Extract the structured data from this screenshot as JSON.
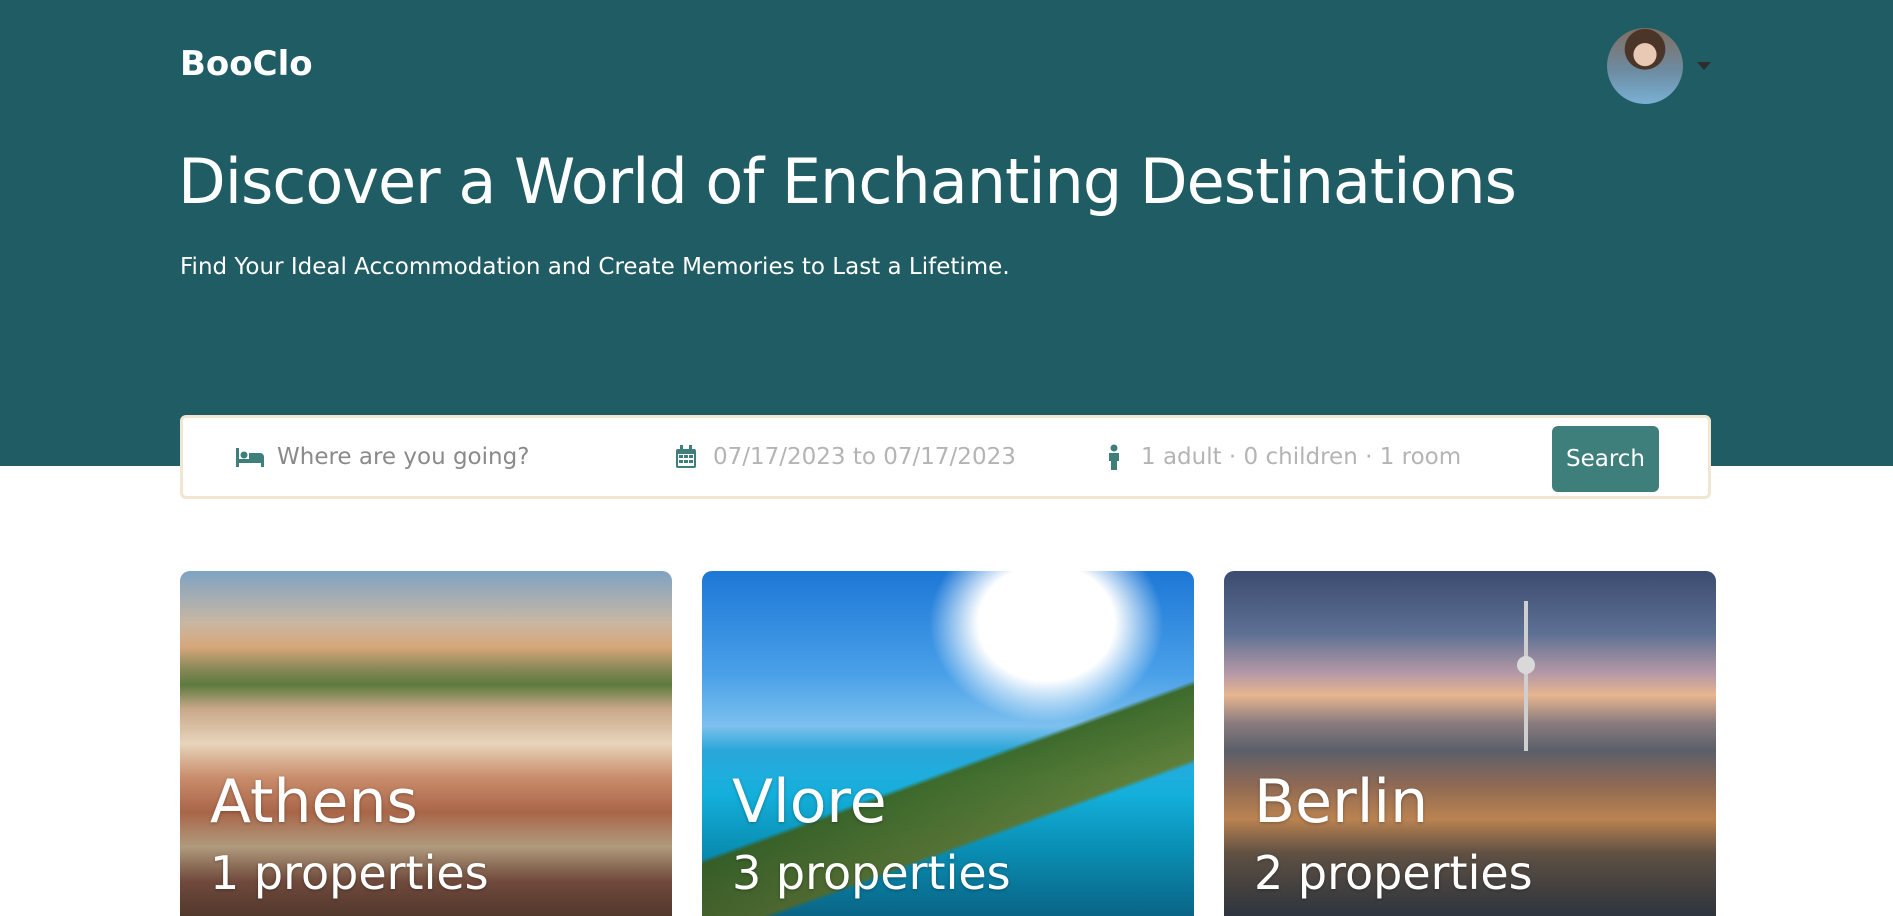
{
  "header": {
    "brand": "BooClo",
    "avatar_icon": "user-avatar",
    "menu_icon": "chevron-down-icon"
  },
  "hero": {
    "title": "Discover a World of Enchanting Destinations",
    "subtitle": "Find Your Ideal Accommodation and Create Memories to Last a Lifetime."
  },
  "search": {
    "destination_placeholder": "Where are you going?",
    "dates_placeholder": "07/17/2023 to 07/17/2023",
    "guests_placeholder": "1 adult · 0 children · 1 room",
    "button_label": "Search",
    "icons": [
      "bed-icon",
      "calendar-icon",
      "person-icon"
    ]
  },
  "destinations": [
    {
      "city": "Athens",
      "properties": "1 properties"
    },
    {
      "city": "Vlore",
      "properties": "3 properties"
    },
    {
      "city": "Berlin",
      "properties": "2 properties"
    }
  ],
  "colors": {
    "hero_bg": "#1f5c63",
    "accent": "#3e7f7c",
    "search_border": "#f1e6d2"
  }
}
